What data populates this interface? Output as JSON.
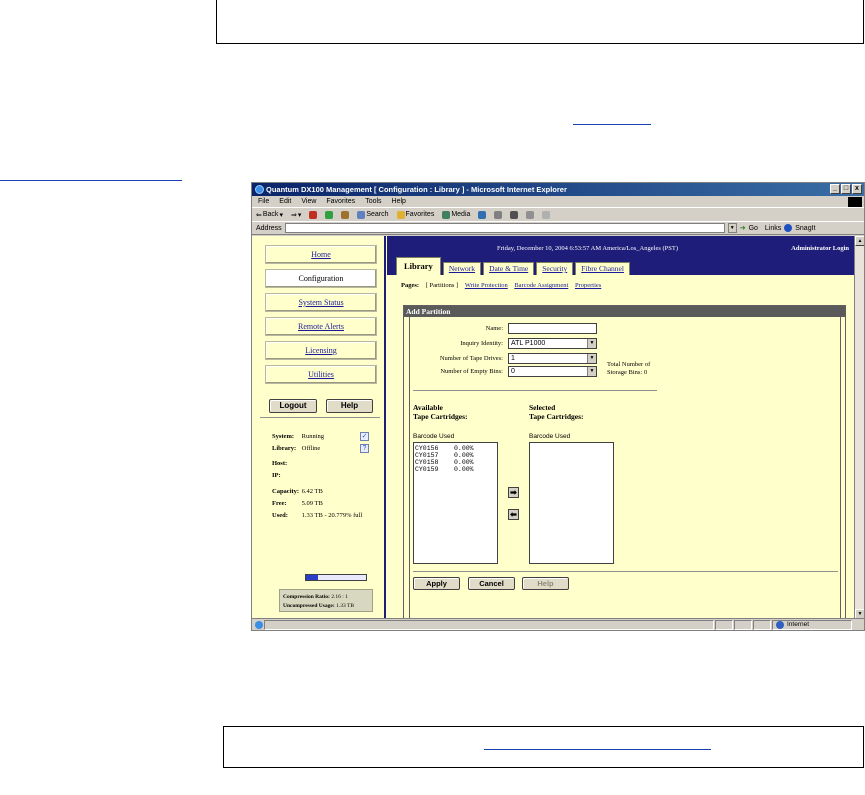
{
  "window": {
    "title": "Quantum DX100 Management [ Configuration : Library ] - Microsoft Internet Explorer",
    "controls": [
      "_",
      "□",
      "x"
    ]
  },
  "menu": [
    "File",
    "Edit",
    "View",
    "Favorites",
    "Tools",
    "Help"
  ],
  "toolbar": {
    "back": "Back",
    "search": "Search",
    "favorites": "Favorites",
    "media": "Media"
  },
  "address": {
    "label": "Address",
    "value": "",
    "go": "Go",
    "links": "Links",
    "snagit": "SnagIt"
  },
  "header": {
    "datetime": "Friday, December 10, 2004 6:53:57 AM America/Los_Angeles (PST)",
    "login": "Administrator Login"
  },
  "tabs": [
    "Library",
    "Network",
    "Date & Time",
    "Security",
    "Fibre Channel"
  ],
  "pages": {
    "label": "Pages:",
    "current": "[ Partitions ]",
    "links": [
      "Write Protection",
      "Barcode Assignment",
      "Properties"
    ]
  },
  "nav": {
    "items": [
      "Home",
      "Configuration",
      "System Status",
      "Remote Alerts",
      "Licensing",
      "Utilities"
    ],
    "active_index": 1,
    "logout": "Logout",
    "help": "Help"
  },
  "status": {
    "system_label": "System:",
    "system_value": "Running",
    "library_label": "Library:",
    "library_value": "Offline",
    "host_label": "Host:",
    "ip_label": "IP:",
    "capacity_label": "Capacity:",
    "capacity_value": "6.42 TB",
    "free_label": "Free:",
    "free_value": "5.09 TB",
    "used_label": "Used:",
    "used_value": "1.33 TB - 20.779% full",
    "used_fraction": 0.20779,
    "compression_label": "Compression Ratio:",
    "compression_value": "2.16 : 1",
    "uncompressed_label": "Uncompressed Usage:",
    "uncompressed_value": "1.33 TB"
  },
  "form": {
    "title": "Add Partition",
    "name_label": "Name:",
    "name_value": "",
    "inquiry_label": "Inquiry Identity:",
    "inquiry_value": "ATL P1000",
    "drives_label": "Number of Tape Drives:",
    "drives_value": "1",
    "bins_label": "Number of Empty Bins:",
    "bins_value": "0",
    "total_bins": "Total Number of Storage Bins: 0",
    "available_title_1": "Available",
    "available_title_2": "Tape Cartridges:",
    "selected_title_1": "Selected",
    "selected_title_2": "Tape Cartridges:",
    "col_header": "Barcode Used",
    "available": [
      {
        "barcode": "CY0156",
        "used": "0.00%"
      },
      {
        "barcode": "CY0157",
        "used": "0.00%"
      },
      {
        "barcode": "CY0158",
        "used": "0.00%"
      },
      {
        "barcode": "CY0159",
        "used": "0.00%"
      }
    ],
    "apply": "Apply",
    "cancel": "Cancel",
    "help": "Help"
  },
  "statusbar": {
    "zone": "Internet"
  }
}
